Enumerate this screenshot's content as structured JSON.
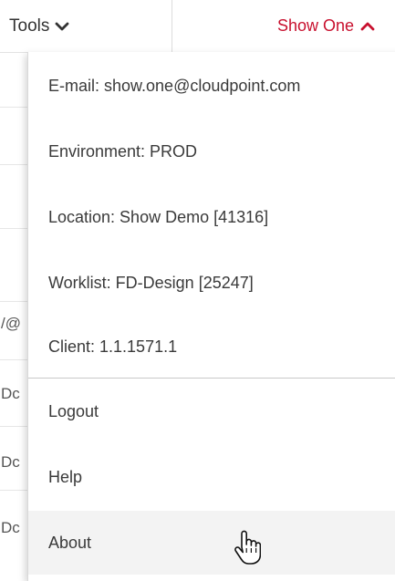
{
  "topbar": {
    "tools_label": "Tools",
    "user_label": "Show One",
    "accent_color": "#c8102e"
  },
  "background_rows": [
    "/@",
    "Dc",
    "Dc",
    "Dc"
  ],
  "dropdown": {
    "info": [
      "E-mail: show.one@cloudpoint.com",
      "Environment: PROD",
      "Location: Show Demo [41316]",
      "Worklist: FD-Design [25247]",
      "Client: 1.1.1571.1"
    ],
    "actions": [
      "Logout",
      "Help",
      "About"
    ],
    "hovered_action": "About"
  },
  "cursor": "hand-pointer"
}
